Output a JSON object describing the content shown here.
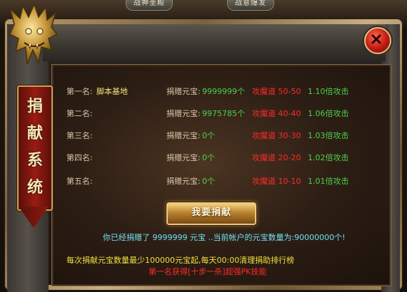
{
  "header": {
    "tags": [
      "战神圣殿",
      "战意爆发"
    ]
  },
  "banner": {
    "chars": [
      "捐",
      "献",
      "系",
      "统"
    ]
  },
  "rows": [
    {
      "rank": "第一名:",
      "name": "脚本基地",
      "label": "捐赠元宝:",
      "amount": "9999999个",
      "attack": "攻魔道 50-50",
      "multiplier": "1.10倍攻击"
    },
    {
      "rank": "第二名:",
      "name": "",
      "label": "捐赠元宝:",
      "amount": "9975785个",
      "attack": "攻魔道 40-40",
      "multiplier": "1.06倍攻击"
    },
    {
      "rank": "第三名:",
      "name": "",
      "label": "捐赠元宝:",
      "amount": "0个",
      "attack": "攻魔道 30-30",
      "multiplier": "1.03倍攻击"
    },
    {
      "rank": "第四名:",
      "name": "",
      "label": "捐赠元宝:",
      "amount": "0个",
      "attack": "攻魔道 20-20",
      "multiplier": "1.02倍攻击"
    },
    {
      "rank": "第五名:",
      "name": "",
      "label": "捐赠元宝:",
      "amount": "0个",
      "attack": "攻魔道 10-10",
      "multiplier": "1.01倍攻击"
    }
  ],
  "donate_button": "我要捐献",
  "status_line": "你已经捐赠了 9999999 元宝 ..当前帐户的元宝数量为:90000000个!",
  "rule_line": "每次捐献元宝数量最少100000元宝起,每天00:00清理捐助排行榜",
  "reward_line": "第一名获得[十步一杀]超强PK技能",
  "colors": {
    "gold": "#f3e37a",
    "green": "#4ad24a",
    "red": "#ff2a2a",
    "cyan": "#6fe0f0",
    "yellow": "#f0e040",
    "banner_red": "#9a1c12"
  },
  "icons": {
    "close": "close-icon",
    "dragon": "dragon-ornament-icon"
  }
}
